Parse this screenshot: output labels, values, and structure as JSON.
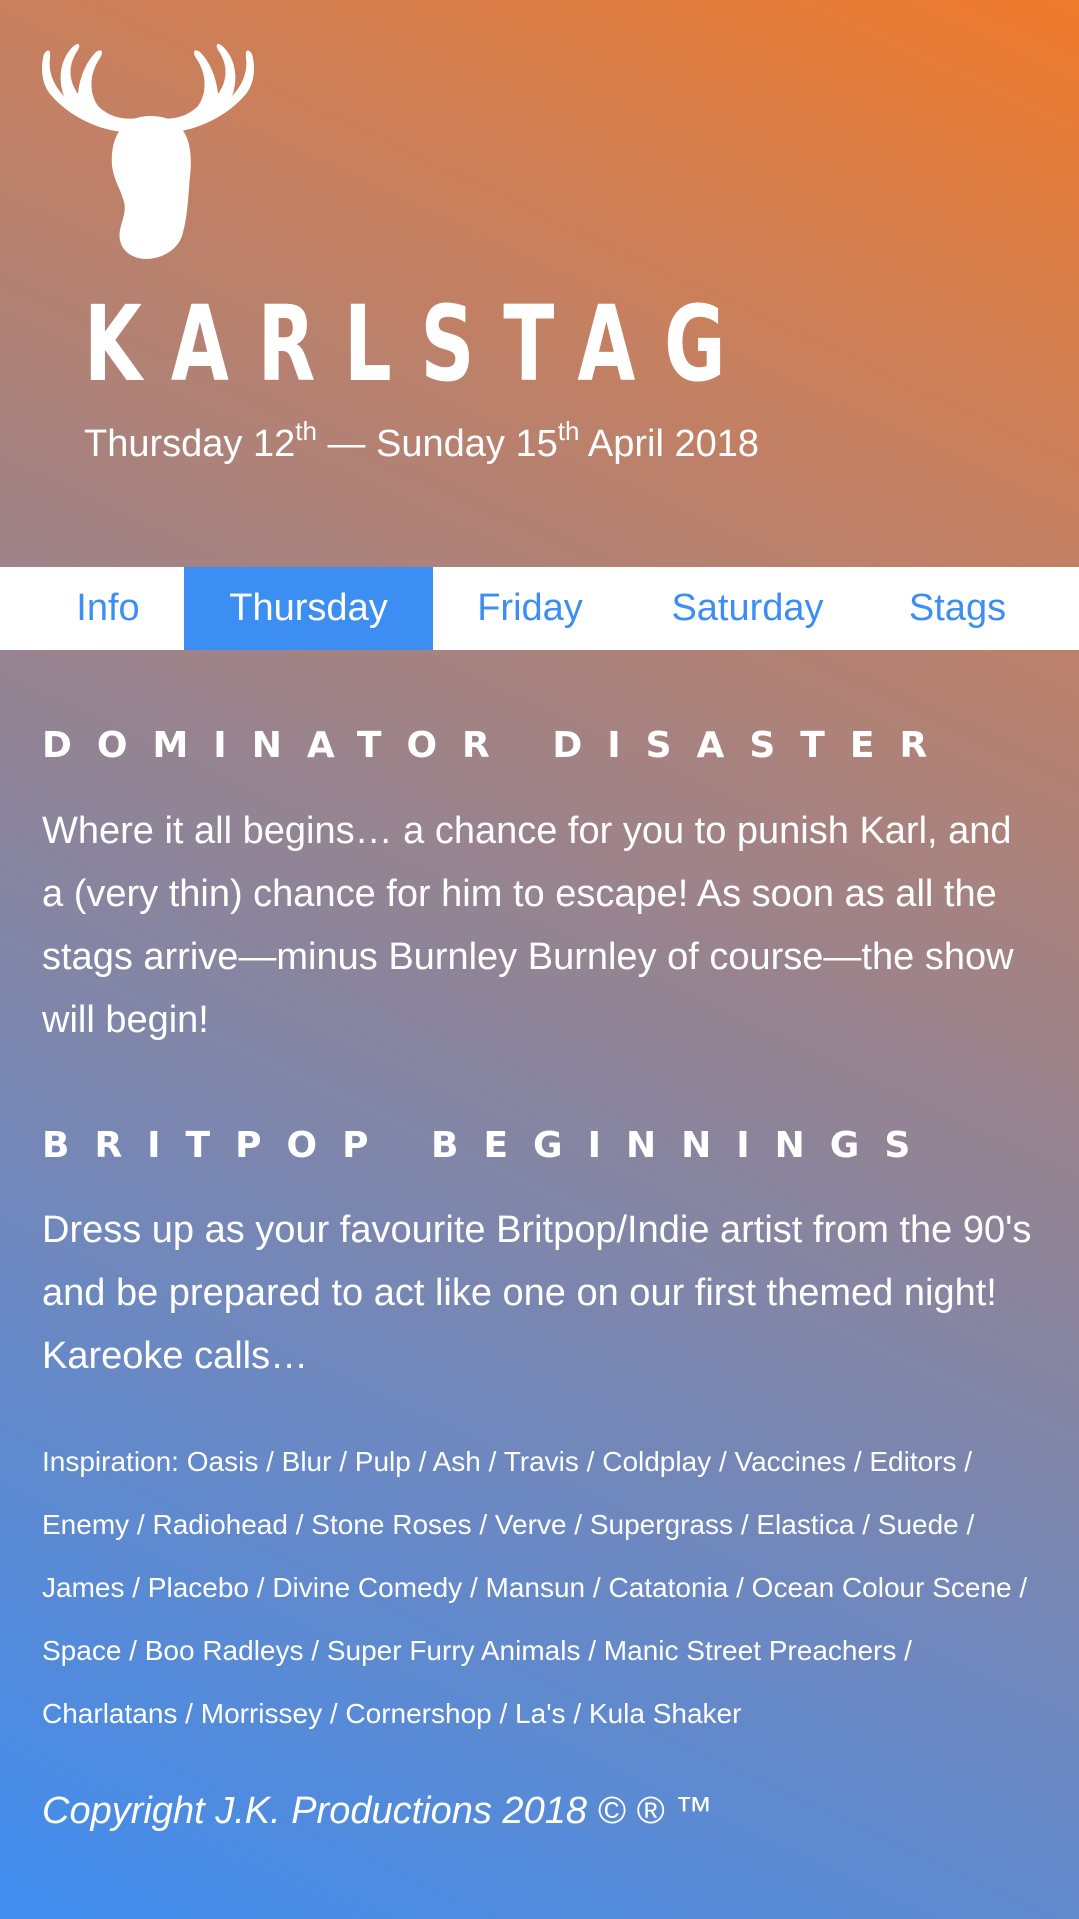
{
  "header": {
    "logo_icon": "stag-head-icon",
    "brand": "KARLSTAG",
    "dates": {
      "start_day": "Thursday 12",
      "start_suffix": "th",
      "separator": " — ",
      "end_day": "Sunday 15",
      "end_suffix": "th",
      "month_year": " April 2018"
    }
  },
  "nav": {
    "tabs": [
      {
        "label": "Info",
        "active": false
      },
      {
        "label": "Thursday",
        "active": true
      },
      {
        "label": "Friday",
        "active": false
      },
      {
        "label": "Saturday",
        "active": false
      },
      {
        "label": "Stags",
        "active": false
      }
    ]
  },
  "sections": [
    {
      "heading": "DOMINATOR DISASTER",
      "text": "Where it all begins… a chance for you to punish Karl, and a (very thin) chance for him to escape! As soon as all the stags arrive—minus Burnley Burnley of course—the show will begin!"
    },
    {
      "heading": "BRITPOP BEGINNINGS",
      "text": "Dress up as your favourite Britpop/Indie artist from the 90's and be prepared to act like one on our first themed night! Kareoke calls…"
    }
  ],
  "inspiration": "Inspiration: Oasis / Blur / Pulp / Ash / Travis / Coldplay / Vaccines / Editors / Enemy / Radiohead / Stone Roses / Verve / Supergrass / Elastica / Suede / James / Placebo / Divine Comedy / Mansun / Catatonia / Ocean Colour Scene / Space / Boo Radleys / Super Furry Animals / Manic Street Preachers / Charlatans / Morrissey / Cornershop / La's / Kula Shaker",
  "footer": {
    "copyright": "Copyright J.K. Productions 2018 © ® ™"
  },
  "colors": {
    "accent": "#3d8ef2",
    "gradient_top_right": "#ef7a2a",
    "gradient_bottom_left": "#3f8df0"
  }
}
